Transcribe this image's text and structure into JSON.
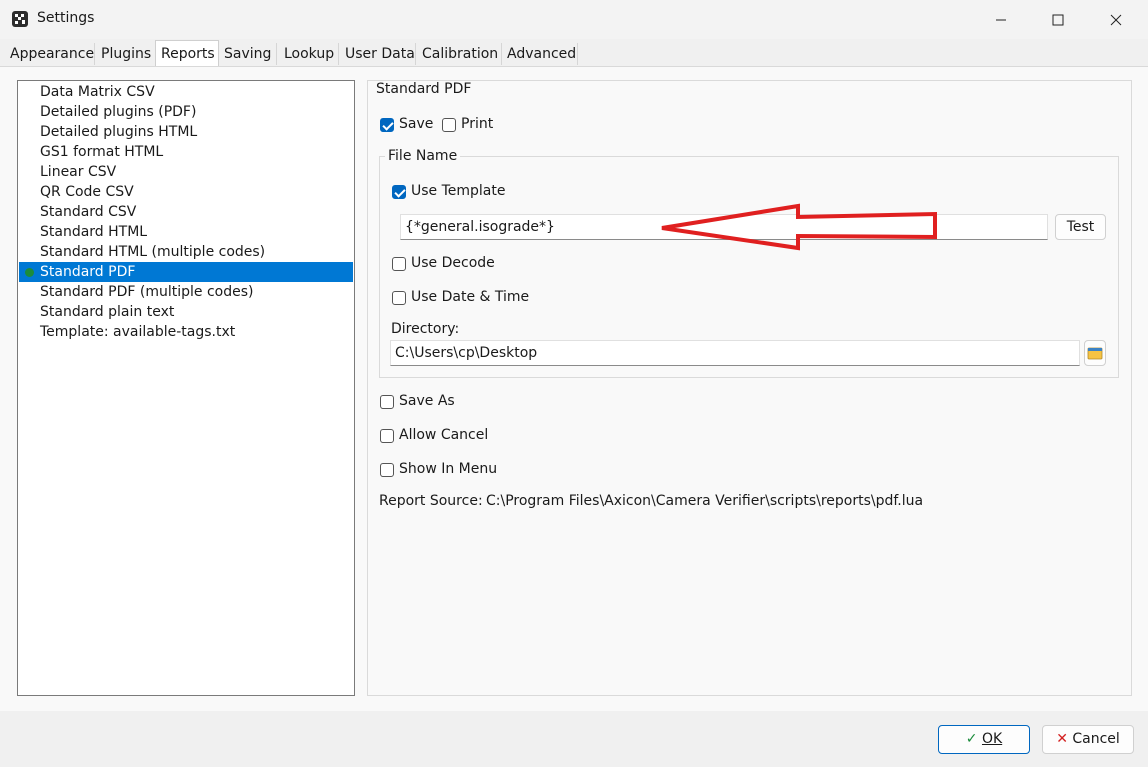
{
  "window": {
    "title": "Settings"
  },
  "tabs": [
    "Appearance",
    "Plugins",
    "Reports",
    "Saving",
    "Lookup",
    "User Data",
    "Calibration",
    "Advanced"
  ],
  "active_tab": "Reports",
  "reports": [
    "Data Matrix CSV",
    "Detailed plugins (PDF)",
    "Detailed plugins HTML",
    "GS1 format HTML",
    "Linear CSV",
    "QR Code CSV",
    "Standard CSV",
    "Standard HTML",
    "Standard HTML (multiple codes)",
    "Standard PDF",
    "Standard PDF (multiple codes)",
    "Standard plain text",
    "Template: available-tags.txt"
  ],
  "selected_report": "Standard PDF",
  "panel": {
    "heading": "Standard PDF",
    "save_label": "Save",
    "save_checked": true,
    "print_label": "Print",
    "print_checked": false,
    "file_name_group": "File Name",
    "use_template_label": "Use Template",
    "use_template_checked": true,
    "template_value": "{*general.isograde*}",
    "test_button": "Test",
    "use_decode_label": "Use Decode",
    "use_datetime_label": "Use Date & Time",
    "directory_label": "Directory:",
    "directory_value": "C:\\Users\\cp\\Desktop",
    "save_as_label": "Save As",
    "allow_cancel_label": "Allow Cancel",
    "show_in_menu_label": "Show In Menu",
    "report_source_label": "Report Source:",
    "report_source_value": "C:\\Program Files\\Axicon\\Camera Verifier\\scripts\\reports\\pdf.lua"
  },
  "footer": {
    "ok_label": "OK",
    "cancel_label": "Cancel"
  },
  "colors": {
    "selection": "#0078d4",
    "accent": "#0067c0",
    "annotation_arrow": "#e02020",
    "status_dot": "#1b8c3c"
  }
}
